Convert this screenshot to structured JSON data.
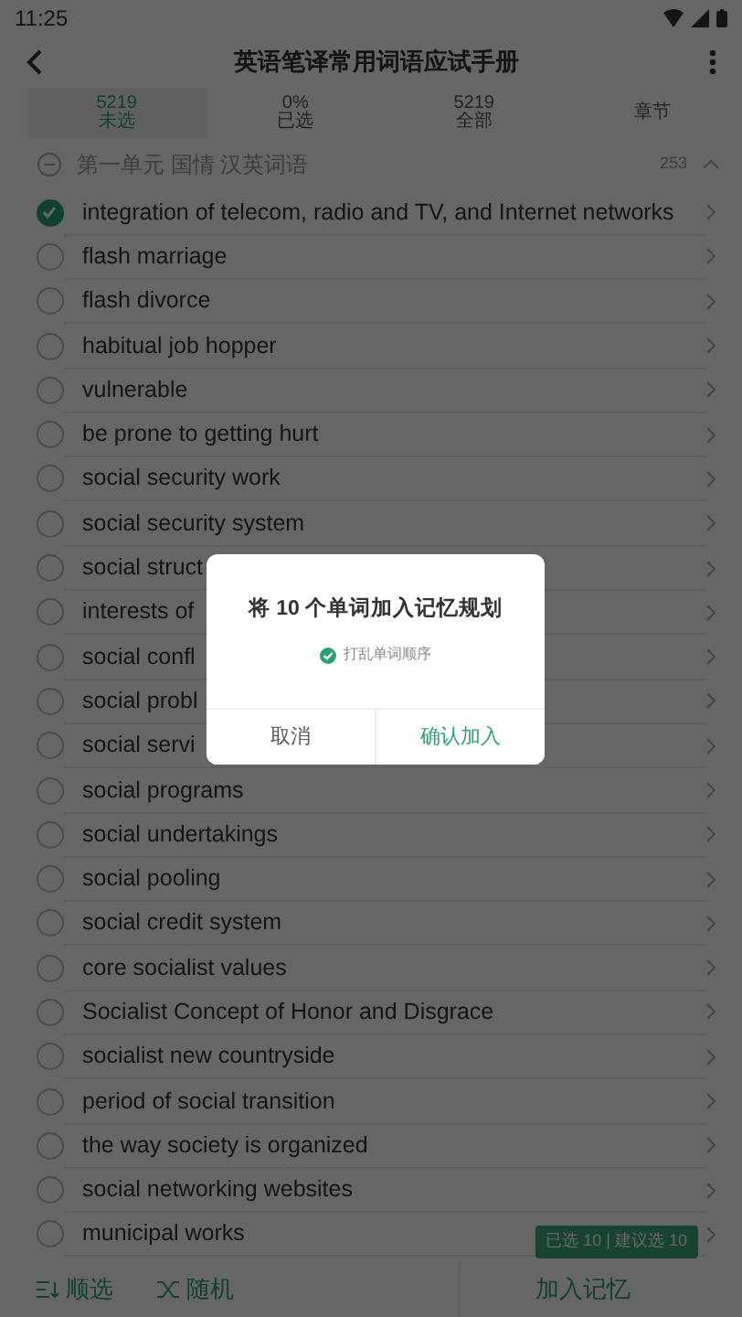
{
  "status_bar": {
    "time": "11:25"
  },
  "app_bar": {
    "title": "英语笔译常用词语应试手册"
  },
  "tabs": [
    {
      "value": "5219",
      "label": "未选",
      "selected": true
    },
    {
      "value": "0%",
      "label": "已选",
      "selected": false
    },
    {
      "value": "5219",
      "label": "全部",
      "selected": false
    },
    {
      "label": "章节",
      "selected": false
    }
  ],
  "section": {
    "title": "第一单元 国情 汉英词语",
    "count": "253",
    "expanded": true
  },
  "words": [
    {
      "text": "integration of telecom, radio and TV, and Internet networks",
      "checked": true
    },
    {
      "text": "flash marriage",
      "checked": false
    },
    {
      "text": "flash divorce",
      "checked": false
    },
    {
      "text": "habitual job hopper",
      "checked": false
    },
    {
      "text": "vulnerable",
      "checked": false
    },
    {
      "text": "be prone to getting hurt",
      "checked": false
    },
    {
      "text": "social security work",
      "checked": false
    },
    {
      "text": "social security system",
      "checked": false
    },
    {
      "text": "social struct",
      "checked": false
    },
    {
      "text": "interests of",
      "checked": false
    },
    {
      "text": "social confl",
      "checked": false
    },
    {
      "text": "social probl",
      "checked": false
    },
    {
      "text": "social servi",
      "checked": false
    },
    {
      "text": "social programs",
      "checked": false
    },
    {
      "text": "social undertakings",
      "checked": false
    },
    {
      "text": "social pooling",
      "checked": false
    },
    {
      "text": "social credit system",
      "checked": false
    },
    {
      "text": "core socialist values",
      "checked": false
    },
    {
      "text": "Socialist Concept of Honor and Disgrace",
      "checked": false
    },
    {
      "text": "socialist new countryside",
      "checked": false
    },
    {
      "text": "period of social transition",
      "checked": false
    },
    {
      "text": "the way society is organized",
      "checked": false
    },
    {
      "text": "social networking websites",
      "checked": false
    },
    {
      "text": "municipal works",
      "checked": false
    }
  ],
  "selection_badge": "已选 10 | 建议选 10",
  "bottom_bar": {
    "order_button": "顺选",
    "random_button": "随机",
    "add_button": "加入记忆"
  },
  "dialog": {
    "title": "将 10 个单词加入记忆规划",
    "option": {
      "label": "打乱单词顺序",
      "checked": true
    },
    "cancel": "取消",
    "confirm": "确认加入"
  }
}
